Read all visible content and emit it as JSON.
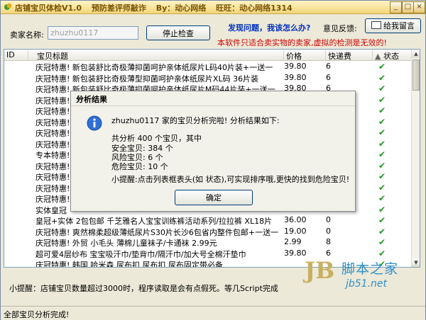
{
  "window": {
    "title_parts": [
      "店铺宝贝体检V1.0",
      "预防差评师敲诈",
      "By：动心网络",
      "旺旺：动心网络1314"
    ]
  },
  "top": {
    "seller_label": "卖家名称:",
    "seller_value": "zhuzhu0117",
    "stop_button": "停止检查",
    "help_link": "发现问题，我该怎么办?",
    "feedback_label": "意见反馈:",
    "feedback_button": "给我留言",
    "notice": "本软件只适合卖实物的卖家,虚拟的检测是无效的!"
  },
  "list": {
    "columns": [
      "ID",
      "宝贝标题",
      "价格",
      "快递费",
      "状态"
    ],
    "rows": [
      {
        "id": "1",
        "title": "庆冠特惠! 新包装舒比奇极薄抑菌呵护亲体纸尿片L码40片装+一送一",
        "price": "39.80",
        "fee": "6",
        "status": "ok"
      },
      {
        "id": "2",
        "title": "庆冠特惠! 新包装舒比奇极薄型抑菌呵护亲体纸尿片XL码 36片装",
        "price": "39.80",
        "fee": "6",
        "status": "ok"
      },
      {
        "id": "3",
        "title": "庆冠特惠! 新包装舒比奇极薄抑菌呵护亲体纸尿片M码44片装+一送一",
        "price": "39.80",
        "fee": "6",
        "status": "ok"
      },
      {
        "id": "4",
        "title": "庆冠特惠!",
        "price": "",
        "fee": "",
        "status": "ok"
      },
      {
        "id": "5",
        "title": "庆冠特惠!",
        "price": "",
        "fee": "",
        "status": "ok"
      },
      {
        "id": "6",
        "title": "庆冠特惠!",
        "price": "",
        "fee": "",
        "status": "ok"
      },
      {
        "id": "7",
        "title": "庆冠特惠!",
        "price": "",
        "fee": "",
        "status": "ok"
      },
      {
        "id": "8",
        "title": "庆冠特惠!",
        "price": "",
        "fee": "",
        "status": "ok"
      },
      {
        "id": "9",
        "title": "专本特惠!",
        "price": "",
        "fee": "",
        "status": "ok"
      },
      {
        "id": "10",
        "title": "庆冠特惠!",
        "price": "",
        "fee": "",
        "status": "ok"
      },
      {
        "id": "11",
        "title": "庆冠特惠!",
        "price": "",
        "fee": "",
        "status": "ok"
      },
      {
        "id": "12",
        "title": "庆冠特惠!",
        "price": "",
        "fee": "",
        "status": "ok"
      },
      {
        "id": "13",
        "title": "庆冠特惠!",
        "price": "",
        "fee": "",
        "status": "ok"
      },
      {
        "id": "14",
        "title": "实体皇冠",
        "price": "",
        "fee": "",
        "status": "ok"
      },
      {
        "id": "15",
        "title": "皇冠+实体 2包包邮 千芝雅名人宝宝训练裤活动系列/拉拉裤 XL18片",
        "price": "36.00",
        "fee": "0",
        "status": "ok"
      },
      {
        "id": "16",
        "title": "庆冠特惠! 爽然棉柔超级薄纸尿片S30片长沙6包省内整件包邮+一送一",
        "price": "19.00",
        "fee": "0",
        "status": "ok"
      },
      {
        "id": "17",
        "title": "庆冠特惠! 外贸 小毛头 薄棉儿童袜子/卡通袜 2.99元",
        "price": "2.99",
        "fee": "8",
        "status": "ok"
      },
      {
        "id": "18",
        "title": "超可爱4层纱布 宝宝吸汗巾/垫背巾/隔汗巾/加大号全棉汗垫巾",
        "price": "39.80",
        "fee": "6",
        "status": "ok"
      },
      {
        "id": "19",
        "title": "庆冠特惠! 韩国 哈米森 尿布扣 尿布扣 尿布固定带必备",
        "price": "",
        "fee": "",
        "status": "ok"
      }
    ]
  },
  "tip": "小提醒：店铺宝贝数量超过3000时，程序读取是会有点假死。等几Script完成",
  "status_bar": "全部宝贝分析完成!",
  "watermark": {
    "logo": "JB",
    "text": "脚本之家",
    "url": "jb51.net"
  },
  "dialog": {
    "title": "分析结果",
    "close": "✕",
    "line1": "zhuzhu0117 家的宝贝分析完啦! 分析结果如下:",
    "line2": "共分析 400 个宝贝，其中",
    "line3": "安全宝贝: 384 个",
    "line4": "风险宝贝: 6 个",
    "line5": "危险宝贝: 10 个",
    "line6": "小提醒:点击列表框表头(如 状态),可实现排序哦,更快的找到危险宝贝!",
    "ok_button": "确定"
  },
  "colors": {
    "title_text": "#7a5200",
    "link_blue": "#0030c0",
    "notice_red": "#d00000",
    "check_green": "#1a9a1a"
  }
}
